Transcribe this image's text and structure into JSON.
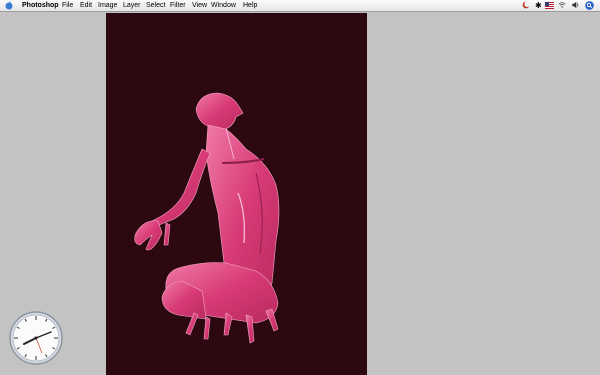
{
  "menubar": {
    "app_name": "Photoshop",
    "menus": [
      {
        "label": "File"
      },
      {
        "label": "Edit"
      },
      {
        "label": "Image"
      },
      {
        "label": "Layer"
      },
      {
        "label": "Select"
      },
      {
        "label": "Filter"
      },
      {
        "label": "View"
      },
      {
        "label": "Window"
      },
      {
        "label": "Help"
      }
    ],
    "tray_bluetooth": "✱"
  },
  "canvas": {
    "background_color": "#2d0810",
    "subject_color": "#e0457f",
    "subject": "figure-illustration"
  },
  "clock": {
    "icon": "analog-clock"
  }
}
